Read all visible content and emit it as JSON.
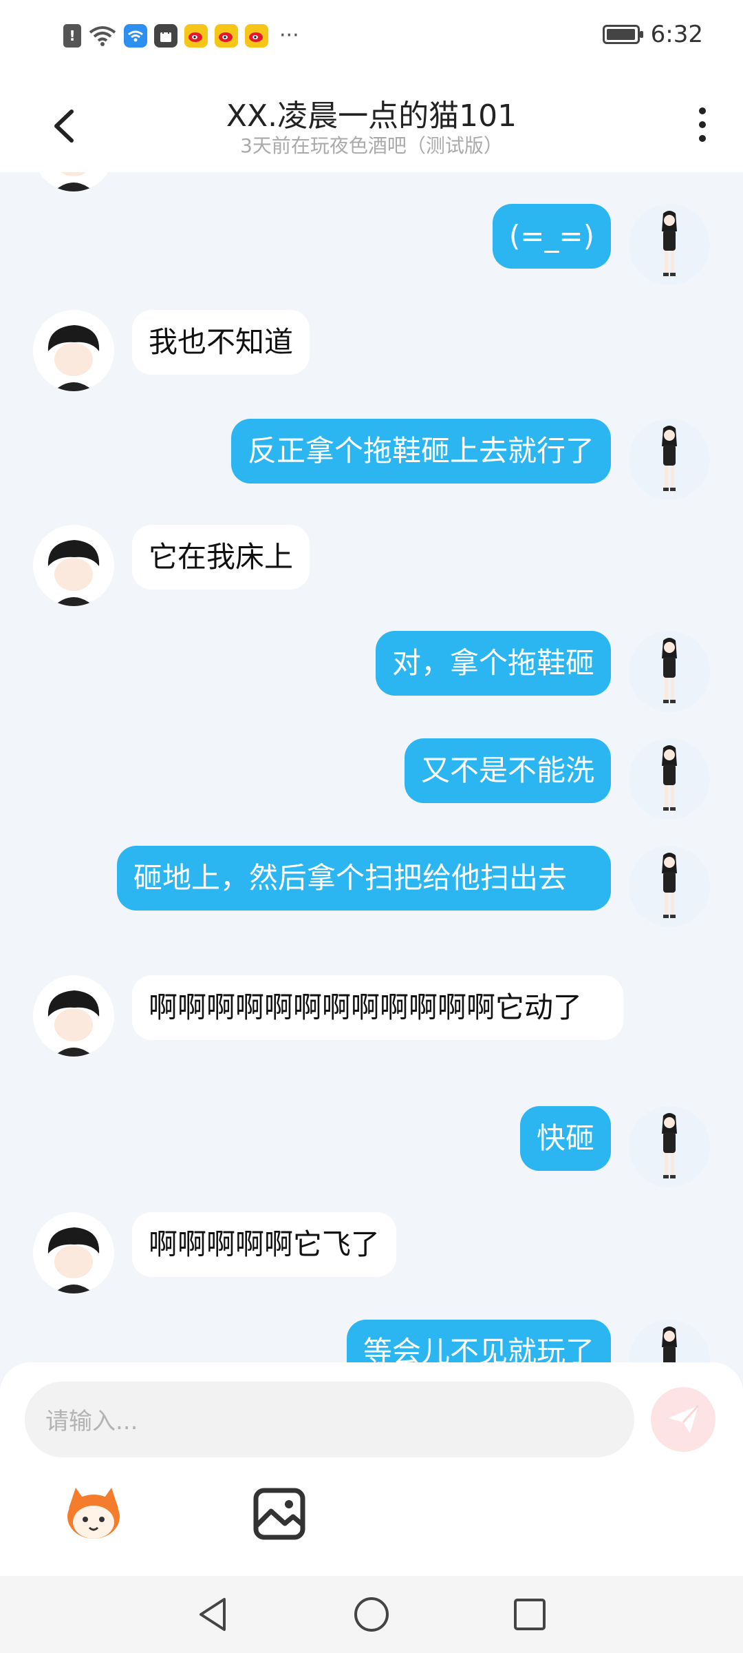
{
  "status_bar": {
    "time": "6:32",
    "overflow": "···",
    "icons": [
      "alert-icon",
      "wifi-icon",
      "wifi-security-app-icon",
      "shopping-bag-icon",
      "weibo-icon",
      "weibo-icon",
      "weibo-icon"
    ]
  },
  "header": {
    "title": "XX.凌晨一点的猫101",
    "subtitle": "3天前在玩夜色酒吧（测试版）"
  },
  "messages": [
    {
      "sender": "self",
      "text": "(=_=)"
    },
    {
      "sender": "other",
      "text": "我也不知道"
    },
    {
      "sender": "self",
      "text": "反正拿个拖鞋砸上去就行了"
    },
    {
      "sender": "other",
      "text": "它在我床上"
    },
    {
      "sender": "self",
      "text": "对，拿个拖鞋砸"
    },
    {
      "sender": "self",
      "text": "又不是不能洗"
    },
    {
      "sender": "self",
      "text": "砸地上，然后拿个扫把给他扫出去"
    },
    {
      "sender": "other",
      "text": "啊啊啊啊啊啊啊啊啊啊啊啊它动了"
    },
    {
      "sender": "self",
      "text": "快砸"
    },
    {
      "sender": "other",
      "text": "啊啊啊啊啊它飞了"
    },
    {
      "sender": "self",
      "text": "等会儿不见就玩了"
    }
  ],
  "composer": {
    "placeholder": "请输入...",
    "send_icon": "send-icon",
    "tools": [
      "sticker-mascot-icon",
      "image-icon"
    ]
  },
  "colors": {
    "self_bubble": "#2bb5f1",
    "other_bubble": "#ffffff",
    "background": "#f2f5f9",
    "send_button": "#fde3e4"
  }
}
